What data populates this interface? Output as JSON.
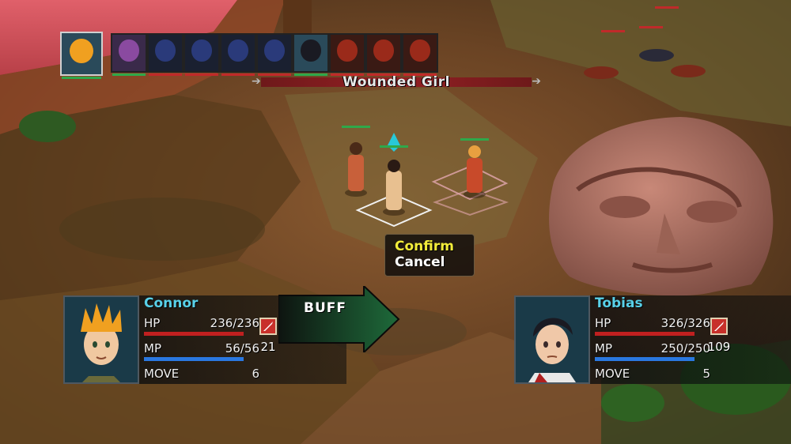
{
  "turn_order": [
    {
      "name": "Connor",
      "icon": "spiky-blond-hair-boy-portrait-icon",
      "side": "ally"
    },
    {
      "name": "girl",
      "icon": "purple-hair-girl-portrait-icon",
      "side": "ally"
    },
    {
      "name": "wolf",
      "icon": "dark-blue-wolf-portrait-icon",
      "side": "enemy"
    },
    {
      "name": "wolf",
      "icon": "dark-blue-wolf-portrait-icon",
      "side": "enemy"
    },
    {
      "name": "wolf",
      "icon": "dark-blue-wolf-portrait-icon",
      "side": "enemy"
    },
    {
      "name": "wolf",
      "icon": "dark-blue-wolf-portrait-icon",
      "side": "enemy"
    },
    {
      "name": "Tobias",
      "icon": "dark-hair-boy-portrait-icon",
      "side": "ally"
    },
    {
      "name": "red-beast",
      "icon": "red-beast-portrait-icon",
      "side": "enemy"
    },
    {
      "name": "red-beast",
      "icon": "red-beast-portrait-icon",
      "side": "enemy"
    },
    {
      "name": "red-beast",
      "icon": "red-beast-portrait-icon",
      "side": "enemy"
    }
  ],
  "target": {
    "label": "Wounded Girl"
  },
  "menu": {
    "confirm": "Confirm",
    "cancel": "Cancel"
  },
  "action": {
    "label": "BUFF"
  },
  "actor": {
    "name": "Connor",
    "hp_label": "HP",
    "hp": "236/236",
    "mp_label": "MP",
    "mp": "56/56",
    "move_label": "MOVE",
    "move": "6",
    "weapon_value": "21",
    "hp_fraction": 1.0,
    "mp_fraction": 1.0
  },
  "target_unit": {
    "name": "Tobias",
    "hp_label": "HP",
    "hp": "326/326",
    "mp_label": "MP",
    "mp": "250/250",
    "move_label": "MOVE",
    "move": "5",
    "weapon_value": "109",
    "hp_fraction": 1.0,
    "mp_fraction": 1.0
  },
  "colors": {
    "ally_hp_line": "#2fa84a",
    "enemy_hp_line": "#c02a2a",
    "hp_gauge": "#c02020",
    "mp_gauge": "#2a78e0",
    "menu_highlight": "#f2ec3a",
    "name_text": "#58d0e8"
  }
}
